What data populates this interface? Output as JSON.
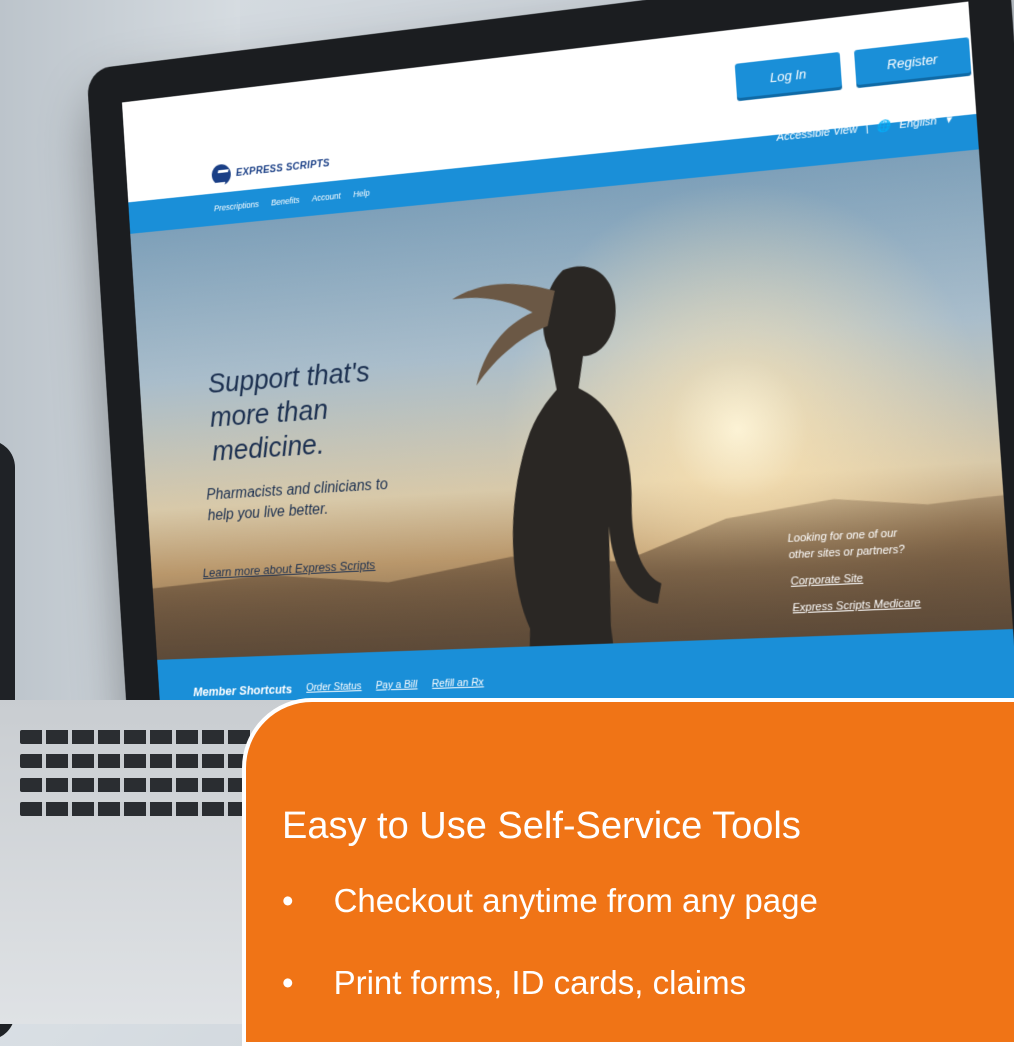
{
  "site": {
    "logo_text": "EXPRESS SCRIPTS",
    "header": {
      "login_label": "Log In",
      "register_label": "Register",
      "accessible_view": "Accessible View",
      "separator": "|",
      "language": "English"
    },
    "nav": [
      "Prescriptions",
      "Benefits",
      "Account",
      "Help"
    ],
    "hero": {
      "headline_lines": [
        "Support that's",
        "more than",
        "medicine."
      ],
      "subtext_lines": [
        "Pharmacists and clinicians to",
        "help you live better."
      ],
      "learn_more_link": "Learn more about Express Scripts"
    },
    "partners": {
      "prompt_lines": [
        "Looking for one of our",
        "other sites or partners?"
      ],
      "links": [
        "Corporate Site",
        "Express Scripts Medicare"
      ]
    },
    "shortcuts": {
      "title": "Member Shortcuts",
      "links": [
        "Order Status",
        "Pay a Bill",
        "Refill an Rx"
      ]
    }
  },
  "callout": {
    "title": "Easy to Use Self-Service Tools",
    "bullets": [
      "Checkout anytime from any page",
      "Print forms, ID cards, claims"
    ]
  },
  "colors": {
    "brand_blue": "#1a8fd8",
    "logo_navy": "#1a3f86",
    "callout_orange": "#f07416"
  }
}
